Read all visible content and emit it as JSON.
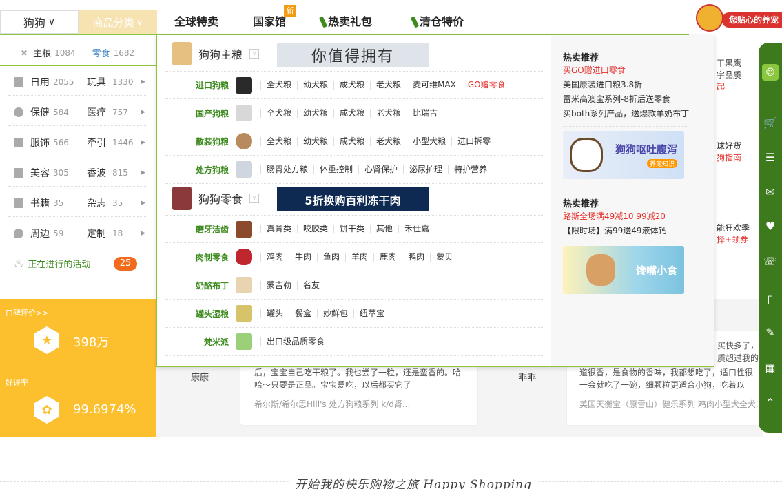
{
  "nav": {
    "pet_select": "狗狗",
    "category_btn": "商品分类",
    "items": [
      "全球特卖",
      "国家馆",
      "热卖礼包",
      "清仓特价"
    ],
    "new_badge": "新",
    "slogan": "您贴心的养宠"
  },
  "sidebar": {
    "top": [
      {
        "name": "主粮",
        "count": "1084"
      },
      {
        "name": "零食",
        "count": "1682"
      }
    ],
    "rows": [
      [
        {
          "name": "日用",
          "count": "2055"
        },
        {
          "name": "玩具",
          "count": "1330"
        }
      ],
      [
        {
          "name": "保健",
          "count": "584"
        },
        {
          "name": "医疗",
          "count": "757"
        }
      ],
      [
        {
          "name": "服饰",
          "count": "566"
        },
        {
          "name": "牵引",
          "count": "1446"
        }
      ],
      [
        {
          "name": "美容",
          "count": "305"
        },
        {
          "name": "香波",
          "count": "815"
        }
      ],
      [
        {
          "name": "书籍",
          "count": "35"
        },
        {
          "name": "杂志",
          "count": "35"
        }
      ],
      [
        {
          "name": "周边",
          "count": "59"
        },
        {
          "name": "定制",
          "count": "18"
        }
      ]
    ],
    "activity": {
      "label": "正在进行的活动",
      "count": "25"
    }
  },
  "stats": {
    "review_label": "口碑评价>>",
    "review_value": "398万",
    "rate_label": "好评率",
    "rate_value": "99.6974%"
  },
  "dropdown": {
    "staple": {
      "title": "狗狗主粮",
      "banner": "你值得拥有",
      "rows": [
        {
          "label": "进口狗粮",
          "tags": [
            "全犬粮",
            "幼犬粮",
            "成犬粮",
            "老犬粮",
            "麦可维MAX"
          ],
          "red_tag": "GO赠零食"
        },
        {
          "label": "国产狗粮",
          "tags": [
            "全犬粮",
            "幼犬粮",
            "成犬粮",
            "老犬粮",
            "比瑞吉"
          ]
        },
        {
          "label": "散装狗粮",
          "tags": [
            "全犬粮",
            "幼犬粮",
            "成犬粮",
            "老犬粮",
            "小型犬粮",
            "进口拆零"
          ]
        },
        {
          "label": "处方狗粮",
          "tags": [
            "肠胃处方粮",
            "体重控制",
            "心肾保护",
            "泌尿护理",
            "特护营养"
          ]
        }
      ]
    },
    "snack": {
      "title": "狗狗零食",
      "banner": "5折换购百利冻干肉",
      "rows": [
        {
          "label": "磨牙洁齿",
          "tags": [
            "真骨类",
            "咬胶类",
            "饼干类",
            "其他",
            "禾仕嘉"
          ]
        },
        {
          "label": "肉制零食",
          "tags": [
            "鸡肉",
            "牛肉",
            "鱼肉",
            "羊肉",
            "鹿肉",
            "鸭肉",
            "蒙贝"
          ]
        },
        {
          "label": "奶酪布丁",
          "tags": [
            "蒙吉勒",
            "名友"
          ]
        },
        {
          "label": "罐头湿粮",
          "tags": [
            "罐头",
            "餐盒",
            "妙鲜包",
            "纽萃宝"
          ]
        },
        {
          "label": "梵米派",
          "tags": [
            "出口级品质零食"
          ]
        }
      ]
    },
    "hot1": {
      "title": "热卖推荐",
      "lines": [
        "买GO赠进口零食",
        "美国原装进口粮3.8折",
        "雷米高澳宝系列-8折后送零食",
        "买both系列产品，送爆款羊奶布丁"
      ],
      "promo_text": "狗狗呕吐腹泻",
      "promo_sub": "养宠知识"
    },
    "hot2": {
      "title": "热卖推荐",
      "lines": [
        "路斯全场满49减10 99减20",
        "【限时场】满99送49液体钙"
      ],
      "promo_text": "馋嘴小食"
    }
  },
  "background": {
    "peek_lines": [
      "干黑鹰",
      "字品质",
      "起",
      "球好货",
      "狗指南",
      "能狂欢季",
      "择+领券"
    ],
    "review1": {
      "user": "康康",
      "text1": "后，宝宝自己吃干粮了。我也尝了一粒，还是蛮香的。哈",
      "text2": "哈～只要是正品。宝宝爱吃，以后都买它了",
      "product": "希尔斯/希尔思Hill's 处方狗粮系列 k/d肾..."
    },
    "review2": {
      "user": "乖乖",
      "text1": "买快多了，",
      "text2": "质超过我的",
      "text3": "道很香，是食物的香味，我都想吃了，适口性很",
      "text4": "一会就吃了一碗，细颗粒更适合小狗，吃着以",
      "product": "美国天衡宝（原雪山）健乐系列 鸡肉小型犬全犬..."
    },
    "footer": "开始我的快乐购物之旅 Happy Shopping"
  },
  "colors": {
    "green": "#3d8b1f",
    "accent": "#8cc63f",
    "yellow": "#fcc02e",
    "red": "#e4312c",
    "orange": "#f26b1d"
  }
}
